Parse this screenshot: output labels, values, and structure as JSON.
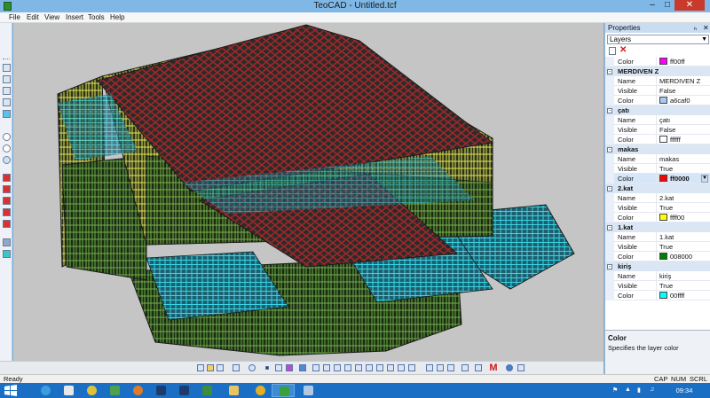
{
  "window": {
    "title": "TeoCAD - Untitled.tcf",
    "minimize": "–",
    "maximize": "□",
    "close": "✕"
  },
  "menu": [
    "File",
    "Edit",
    "View",
    "Insert",
    "Tools",
    "Help"
  ],
  "left_toolbar": {
    "icons": [
      "cube-front-icon",
      "cube-top-icon",
      "cube-side-icon",
      "cube-iso-icon",
      "cube-color-icon",
      "zoom-in-icon",
      "zoom-out-icon",
      "zoom-extents-icon",
      "red-box-1-icon",
      "red-box-2-icon",
      "red-box-3-icon",
      "red-box-4-icon",
      "red-box-5-icon",
      "layer-stack-icon",
      "layer-grid-icon"
    ]
  },
  "bottom_toolbar": {
    "icons": [
      "new-icon",
      "open-icon",
      "save-icon",
      "print-icon",
      "undo-icon",
      "point-icon",
      "line-icon",
      "erase-icon",
      "grid-icon",
      "wall-1-icon",
      "wall-2-icon",
      "wall-3-icon",
      "wall-4-icon",
      "wall-5-icon",
      "wall-6-icon",
      "wall-7-icon",
      "wall-8-icon",
      "wall-9-icon",
      "wall-10-icon",
      "wall-11-icon",
      "wall-12-icon",
      "wall-13-icon",
      "move-icon",
      "move-2-icon",
      "trim-icon",
      "dimension-icon",
      "array-icon",
      "help-icon",
      "settings-icon"
    ],
    "m_label": "M"
  },
  "properties": {
    "title": "Properties",
    "pin": "ₕ",
    "close": "✕",
    "selector": "Layers",
    "top_row": {
      "name": "Color",
      "value": "ff00ff",
      "color": "#ff00ff"
    },
    "layers": [
      {
        "name": "MERDIVEN Z",
        "rows": [
          {
            "name": "Name",
            "value": "MERDIVEN Z"
          },
          {
            "name": "Visible",
            "value": "False"
          },
          {
            "name": "Color",
            "value": "a6caf0",
            "color": "#a6caf0"
          }
        ]
      },
      {
        "name": "çatı",
        "rows": [
          {
            "name": "Name",
            "value": "çatı"
          },
          {
            "name": "Visible",
            "value": "False"
          },
          {
            "name": "Color",
            "value": "ffffff",
            "color": "#ffffff"
          }
        ]
      },
      {
        "name": "makas",
        "rows": [
          {
            "name": "Name",
            "value": "makas"
          },
          {
            "name": "Visible",
            "value": "True"
          },
          {
            "name": "Color",
            "value": "ff0000",
            "color": "#ff0000",
            "selected": true
          }
        ]
      },
      {
        "name": "2.kat",
        "rows": [
          {
            "name": "Name",
            "value": "2.kat"
          },
          {
            "name": "Visible",
            "value": "True"
          },
          {
            "name": "Color",
            "value": "ffff00",
            "color": "#ffff00"
          }
        ]
      },
      {
        "name": "1.kat",
        "rows": [
          {
            "name": "Name",
            "value": "1.kat"
          },
          {
            "name": "Visible",
            "value": "True"
          },
          {
            "name": "Color",
            "value": "008000",
            "color": "#008000"
          }
        ]
      },
      {
        "name": "kiriş",
        "rows": [
          {
            "name": "Name",
            "value": "kiriş"
          },
          {
            "name": "Visible",
            "value": "True"
          },
          {
            "name": "Color",
            "value": "00ffff",
            "color": "#00ffff"
          }
        ]
      }
    ],
    "help_title": "Color",
    "help_desc": "Specifies the layer color"
  },
  "status": {
    "text": "Ready",
    "cap": "CAP",
    "num": "NUM",
    "scrl": "SCRL"
  },
  "taskbar": {
    "apps": [
      {
        "name": "ie",
        "color": "#3b9de0"
      },
      {
        "name": "yandex",
        "color": "#e8e8e8"
      },
      {
        "name": "chrome",
        "color": "#e0c13a"
      },
      {
        "name": "green-app",
        "color": "#4da04d"
      },
      {
        "name": "firefox",
        "color": "#e07a2a"
      },
      {
        "name": "photoshop-1",
        "color": "#1d3c6e"
      },
      {
        "name": "photoshop-2",
        "color": "#1d3c6e"
      },
      {
        "name": "excel",
        "color": "#3c8c3c"
      },
      {
        "name": "folder",
        "color": "#e8c560"
      },
      {
        "name": "autocad",
        "color": "#e2b027"
      },
      {
        "name": "teocad",
        "color": "#3aa13a",
        "active": true
      },
      {
        "name": "monitor",
        "color": "#b0c8e4"
      }
    ],
    "clock": "09:34"
  }
}
